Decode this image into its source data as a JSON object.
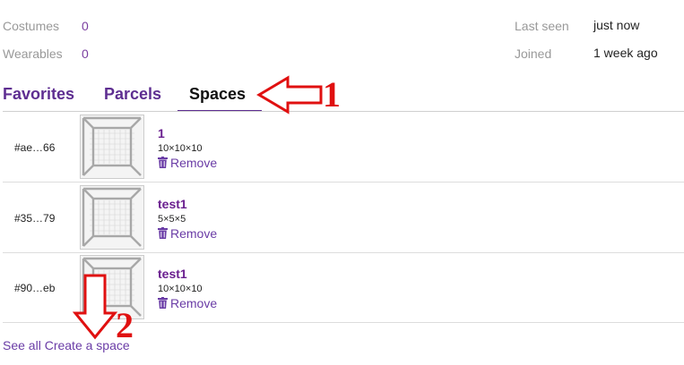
{
  "stats": {
    "costumes_label": "Costumes",
    "costumes_value": "0",
    "wearables_label": "Wearables",
    "wearables_value": "0",
    "last_seen_label": "Last seen",
    "last_seen_value": "just now",
    "joined_label": "Joined",
    "joined_value": "1 week ago"
  },
  "tabs": [
    {
      "label": "Favorites",
      "active": false
    },
    {
      "label": "Parcels",
      "active": false
    },
    {
      "label": "Spaces",
      "active": true
    }
  ],
  "spaces": [
    {
      "id": "#ae…66",
      "name": "1",
      "size": "10×10×10",
      "remove_label": "Remove"
    },
    {
      "id": "#35…79",
      "name": "test1",
      "size": "5×5×5",
      "remove_label": "Remove"
    },
    {
      "id": "#90…eb",
      "name": "test1",
      "size": "10×10×10",
      "remove_label": "Remove"
    }
  ],
  "footer": {
    "see_all": "See all",
    "create": "Create a space"
  },
  "annotations": {
    "one": "1",
    "two": "2"
  },
  "colors": {
    "accent": "#5e2e91",
    "link": "#6a3ca6",
    "annotation": "#e01010"
  }
}
